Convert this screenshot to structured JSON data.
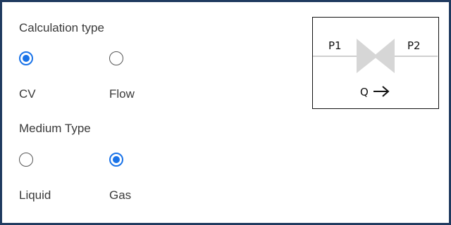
{
  "calculation_type": {
    "heading": "Calculation type",
    "options": [
      {
        "label": "CV",
        "selected": true
      },
      {
        "label": "Flow",
        "selected": false
      }
    ]
  },
  "medium_type": {
    "heading": "Medium Type",
    "options": [
      {
        "label": "Liquid",
        "selected": false
      },
      {
        "label": "Gas",
        "selected": true
      }
    ]
  },
  "valve_diagram": {
    "inlet_label": "P1",
    "outlet_label": "P2",
    "flow_label": "Q"
  },
  "colors": {
    "accent": "#1a73e8",
    "frame_border": "#1f3a5f",
    "valve_fill": "#d6d6d6"
  }
}
